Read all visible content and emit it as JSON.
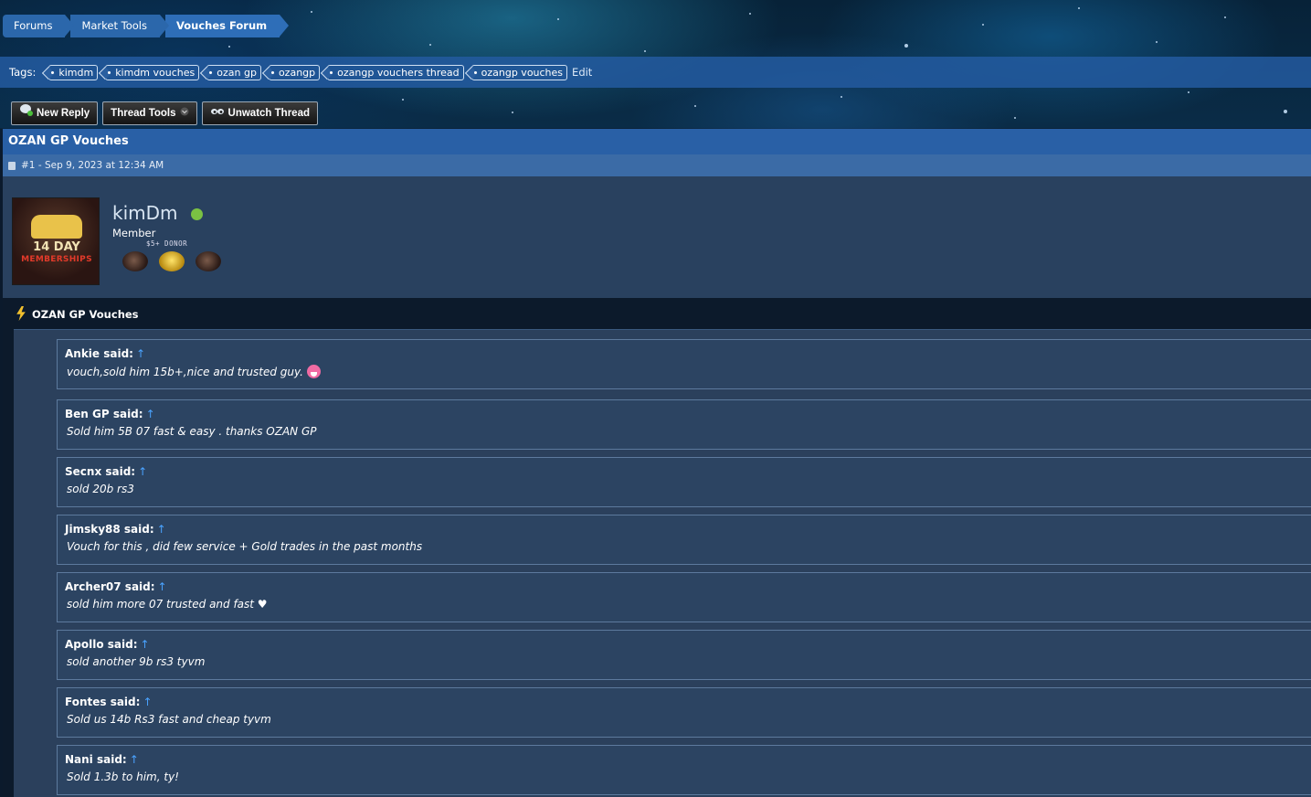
{
  "breadcrumb": [
    "Forums",
    "Market Tools",
    "Vouches Forum"
  ],
  "tags": {
    "label": "Tags:",
    "items": [
      "kimdm",
      "kimdm vouches",
      "ozan gp",
      "ozangp",
      "ozangp vouchers thread",
      "ozangp vouches"
    ],
    "edit": "Edit"
  },
  "toolbar": {
    "new_reply": "New Reply",
    "thread_tools": "Thread Tools",
    "unwatch": "Unwatch Thread"
  },
  "thread": {
    "title": "OZAN GP Vouches"
  },
  "post": {
    "meta": "#1 - Sep 9, 2023 at 12:34 AM",
    "avatar_line1": "14 DAY",
    "avatar_line2": "MEMBERSHIPS",
    "username": "kimDm",
    "usertitle": "Member",
    "donor": "$5+ DONOR",
    "body_title": "OZAN GP Vouches",
    "arrow": "↑",
    "quotes": [
      {
        "author": "Ankie said:",
        "text": "vouch,sold him 15b+,nice and trusted guy."
      },
      {
        "author": "Ben GP said:",
        "text": "Sold him 5B 07 fast & easy . thanks OZAN GP"
      },
      {
        "author": "Secnx said:",
        "text": "sold 20b rs3"
      },
      {
        "author": "Jimsky88 said:",
        "text": "Vouch for this , did few service + Gold trades in the past months"
      },
      {
        "author": "Archer07 said:",
        "text": "sold him more 07 trusted and fast ♥"
      },
      {
        "author": "Apollo said:",
        "text": "sold another 9b rs3 tyvm"
      },
      {
        "author": "Fontes said:",
        "text": "Sold us 14b Rs3 fast and cheap tyvm"
      },
      {
        "author": "Nani said:",
        "text": "Sold 1.3b to him, ty!"
      }
    ]
  },
  "colors": {
    "accent": "#2960a6",
    "online": "#7ac143",
    "quote_arrow": "#4aa3ff"
  }
}
